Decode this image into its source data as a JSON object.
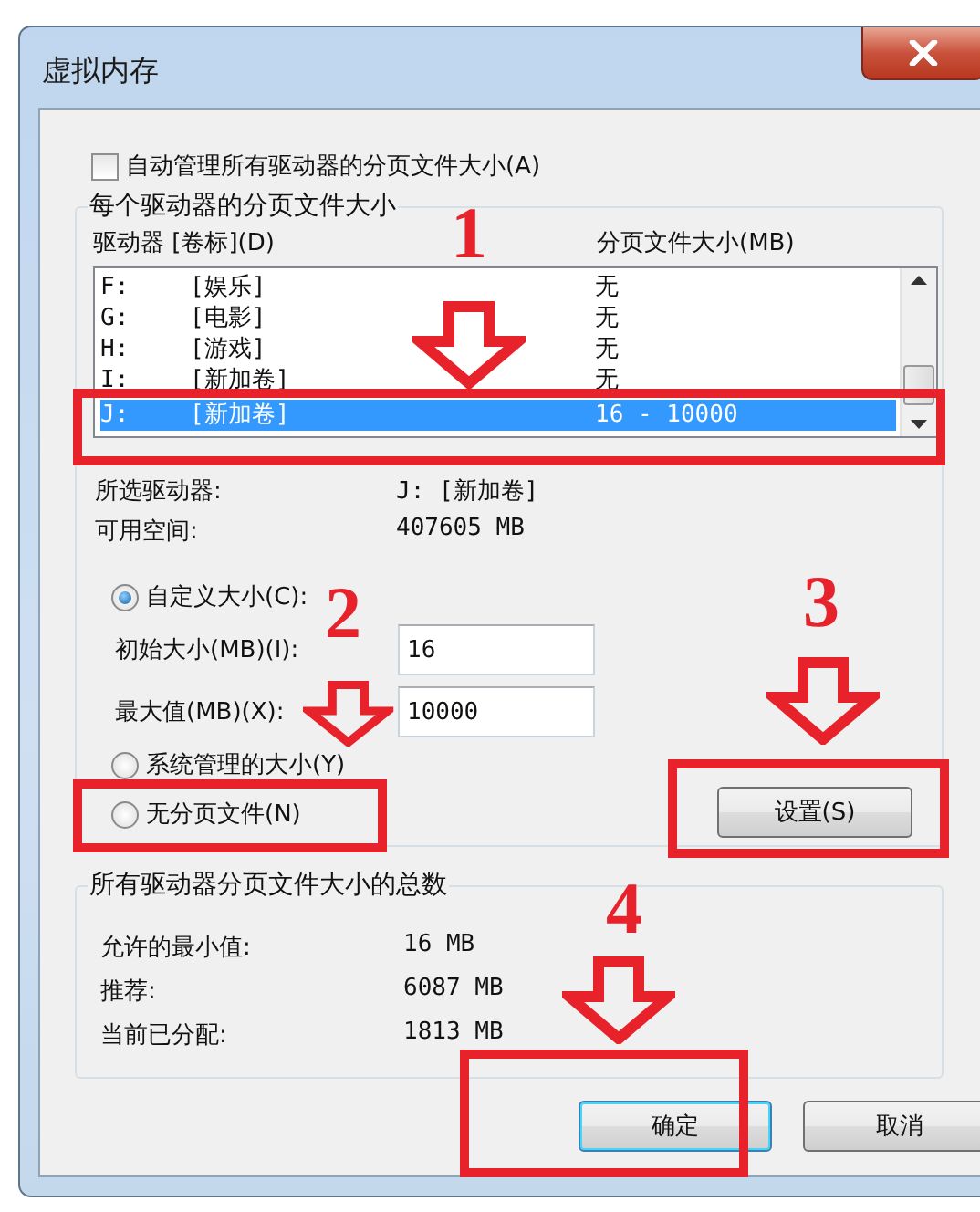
{
  "window": {
    "title": "虚拟内存"
  },
  "auto_manage": {
    "label": "自动管理所有驱动器的分页文件大小(A)",
    "checked": false
  },
  "per_drive": {
    "title": "每个驱动器的分页文件大小",
    "columns": [
      "驱动器 [卷标](D)",
      "分页文件大小(MB)"
    ],
    "rows": [
      {
        "drive": "F:",
        "volume": "[娱乐]",
        "size": "无",
        "selected": false
      },
      {
        "drive": "G:",
        "volume": "[电影]",
        "size": "无",
        "selected": false
      },
      {
        "drive": "H:",
        "volume": "[游戏]",
        "size": "无",
        "selected": false
      },
      {
        "drive": "I:",
        "volume": "[新加卷]",
        "size": "无",
        "selected": false
      },
      {
        "drive": "J:",
        "volume": "[新加卷]",
        "size": "16 - 10000",
        "selected": true
      }
    ],
    "selected_drive": {
      "label": "所选驱动器:",
      "value": "J:  [新加卷]"
    },
    "free_space": {
      "label": "可用空间:",
      "value": "407605 MB"
    },
    "custom_size": {
      "label": "自定义大小(C):",
      "selected": true
    },
    "initial_size": {
      "label": "初始大小(MB)(I):",
      "value": "16"
    },
    "max_size": {
      "label": "最大值(MB)(X):",
      "value": "10000"
    },
    "system_managed": {
      "label": "系统管理的大小(Y)",
      "selected": false
    },
    "no_paging": {
      "label": "无分页文件(N)",
      "selected": false
    },
    "set_button": "设置(S)"
  },
  "totals": {
    "title": "所有驱动器分页文件大小的总数",
    "rows": [
      {
        "label": "允许的最小值:",
        "value": "16 MB"
      },
      {
        "label": "推荐:",
        "value": "6087 MB"
      },
      {
        "label": "当前已分配:",
        "value": "1813 MB"
      }
    ]
  },
  "buttons": [
    {
      "label": "确定",
      "default": true
    },
    {
      "label": "取消",
      "default": false
    }
  ],
  "annotations": [
    {
      "number": "1"
    },
    {
      "number": "2"
    },
    {
      "number": "3"
    },
    {
      "number": "4"
    }
  ]
}
